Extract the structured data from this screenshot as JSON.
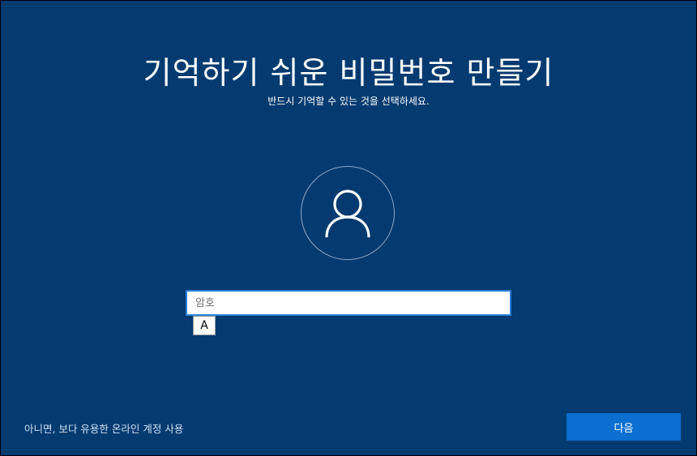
{
  "header": {
    "title": "기억하기 쉬운 비밀번호 만들기",
    "subtitle": "반드시 기억할 수 있는 것을 선택하세요."
  },
  "avatar": {
    "icon": "user-icon"
  },
  "password": {
    "placeholder": "암호",
    "value": ""
  },
  "ime": {
    "mode_label": "A"
  },
  "footer": {
    "online_account_link": "아니면, 보다 유용한 온라인 계정 사용",
    "next_label": "다음"
  },
  "colors": {
    "background": "#033a70",
    "accent": "#0a6fd0",
    "input_border": "#2b7fd6"
  }
}
